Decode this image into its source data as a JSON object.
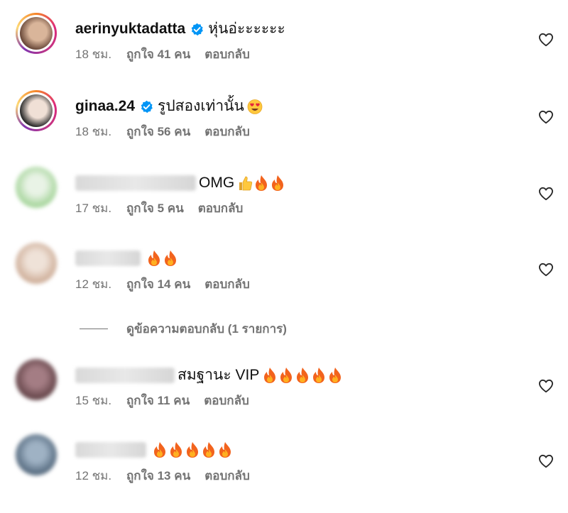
{
  "comments": [
    {
      "username": "aerinyuktadatta",
      "verified": true,
      "text": "หุ่นอ่ะะะะะะ",
      "emojis": [],
      "time": "18 ชม.",
      "likes": "ถูกใจ 41 คน",
      "reply": "ตอบกลับ",
      "avatar_colors": [
        "#6b4a3a",
        "#d9b59a"
      ]
    },
    {
      "username": "ginaa.24",
      "verified": true,
      "text": "รูปสองเท่านั้น",
      "emojis": [
        "heart-eyes-emoji"
      ],
      "time": "18 ชม.",
      "likes": "ถูกใจ 56 คน",
      "reply": "ตอบกลับ",
      "avatar_colors": [
        "#2b2b2b",
        "#f0e0d6"
      ]
    },
    {
      "username": "",
      "verified": false,
      "text": "OMG",
      "emojis": [
        "thumbs-up-emoji",
        "fire-emoji",
        "fire-emoji"
      ],
      "time": "17 ชม.",
      "likes": "ถูกใจ 5 คน",
      "reply": "ตอบกลับ",
      "avatar_colors": [
        "#9bd08f",
        "#e9f3e6"
      ]
    },
    {
      "username": "",
      "verified": false,
      "text": "",
      "emojis": [
        "fire-emoji",
        "fire-emoji"
      ],
      "time": "12 ชม.",
      "likes": "ถูกใจ 14 คน",
      "reply": "ตอบกลับ",
      "avatar_colors": [
        "#c9a68f",
        "#efe2d8"
      ]
    },
    {
      "username": "",
      "verified": false,
      "text": "สมฐานะ VIP",
      "emojis": [
        "fire-emoji",
        "fire-emoji",
        "fire-emoji",
        "fire-emoji",
        "fire-emoji"
      ],
      "time": "15 ชม.",
      "likes": "ถูกใจ 11 คน",
      "reply": "ตอบกลับ",
      "avatar_colors": [
        "#5a3b3f",
        "#a47d84"
      ]
    },
    {
      "username": "",
      "verified": false,
      "text": "",
      "emojis": [
        "fire-emoji",
        "fire-emoji",
        "fire-emoji",
        "fire-emoji",
        "fire-emoji"
      ],
      "time": "12 ชม.",
      "likes": "ถูกใจ 13 คน",
      "reply": "ตอบกลับ",
      "avatar_colors": [
        "#4a5f74",
        "#9fb2c4"
      ]
    }
  ],
  "view_replies_label": "ดูข้อความตอบกลับ (1 รายการ)",
  "colors": {
    "verified": "#0095f6",
    "meta": "#737373",
    "fire": "#f2631d"
  }
}
